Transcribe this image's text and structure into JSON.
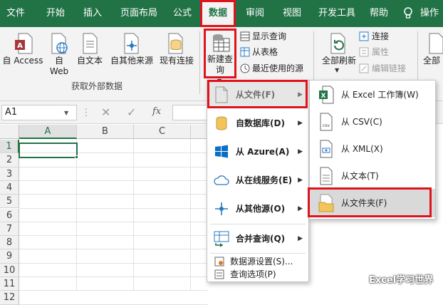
{
  "tabs": [
    "文件",
    "开始",
    "插入",
    "页面布局",
    "公式",
    "数据",
    "审阅",
    "视图",
    "开发工具",
    "帮助",
    "操作"
  ],
  "tab_help_icon": "lightbulb-icon",
  "ribbon": {
    "from_access": "自 Access",
    "from_web_1": "自",
    "from_web_2": "Web",
    "from_text": "自文本",
    "from_other": "自其他来源",
    "existing": "现有连接",
    "group_external": "获取外部数据",
    "new_query_1": "新建查",
    "new_query_2": "询",
    "show_queries": "显示查询",
    "from_table": "从表格",
    "recent_sources": "最近使用的源",
    "refresh_all": "全部刷新",
    "connections": "连接",
    "properties": "属性",
    "edit_links": "编辑链接",
    "all": "全部"
  },
  "formula": {
    "namebox": "A1",
    "fx": "fx"
  },
  "grid": {
    "columns": [
      "A",
      "B",
      "C"
    ],
    "rows": [
      "1",
      "2",
      "3",
      "4",
      "5",
      "6",
      "7",
      "8",
      "9",
      "10",
      "11",
      "12"
    ]
  },
  "menu": {
    "items": [
      {
        "label": "从文件(F)",
        "icon": "file-icon"
      },
      {
        "label": "自数据库(D)",
        "icon": "database-icon"
      },
      {
        "label": "从 Azure(A)",
        "icon": "azure-icon"
      },
      {
        "label": "从在线服务(E)",
        "icon": "cloud-icon"
      },
      {
        "label": "从其他源(O)",
        "icon": "other-source-icon"
      },
      {
        "label": "合并查询(Q)",
        "icon": "merge-query-icon"
      }
    ],
    "settings": "数据源设置(S)...",
    "options": "查询选项(P)"
  },
  "submenu": {
    "items": [
      {
        "label": "从 Excel 工作簿(W)",
        "icon": "excel-workbook-icon"
      },
      {
        "label": "从 CSV(C)",
        "icon": "csv-file-icon"
      },
      {
        "label": "从 XML(X)",
        "icon": "xml-file-icon"
      },
      {
        "label": "从文本(T)",
        "icon": "text-file-icon"
      },
      {
        "label": "从文件夹(F)",
        "icon": "folder-icon"
      }
    ]
  },
  "watermark": "Excel学习世界",
  "colors": {
    "excel_green": "#217346",
    "highlight_red": "#e0131c"
  }
}
